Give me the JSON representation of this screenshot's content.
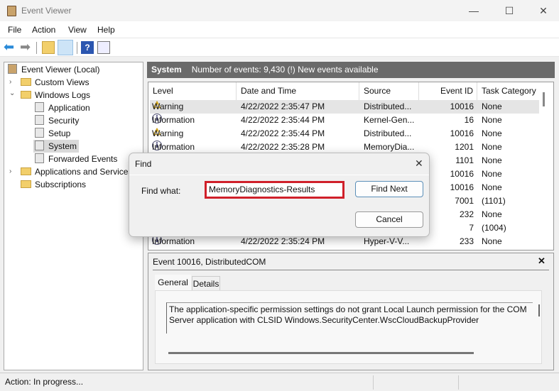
{
  "window": {
    "title": "Event Viewer",
    "minimize": "—",
    "maximize": "☐",
    "close": "✕"
  },
  "menu": [
    "File",
    "Action",
    "View",
    "Help"
  ],
  "toolbar": {
    "icons": [
      "back-arrow-icon",
      "forward-arrow-icon",
      "up-folder-icon",
      "show-hide-console-tree-icon",
      "help-icon",
      "show-hide-action-pane-icon"
    ],
    "help_glyph": "?"
  },
  "tree": [
    {
      "label": "Event Viewer (Local)",
      "icon": "event-viewer-icon"
    },
    {
      "label": "Custom Views",
      "icon": "folder-filter-icon",
      "chevron": "›"
    },
    {
      "label": "Windows Logs",
      "icon": "folder-log-icon",
      "chevron": "⌄"
    },
    {
      "label": "Application",
      "icon": "log-icon"
    },
    {
      "label": "Security",
      "icon": "log-icon"
    },
    {
      "label": "Setup",
      "icon": "log-icon"
    },
    {
      "label": "System",
      "icon": "log-icon",
      "selected": true
    },
    {
      "label": "Forwarded Events",
      "icon": "log-icon"
    },
    {
      "label": "Applications and Services",
      "icon": "folder-icon",
      "chevron": "›"
    },
    {
      "label": "Subscriptions",
      "icon": "subscriptions-icon"
    }
  ],
  "header": {
    "log": "System",
    "info": "Number of events: 9,430 (!) New events available"
  },
  "table": {
    "columns": [
      "Level",
      "Date and Time",
      "Source",
      "Event ID",
      "Task Category"
    ],
    "rows": [
      {
        "level": "Warning",
        "date": "4/22/2022 2:35:47 PM",
        "source": "Distributed...",
        "id": "10016",
        "task": "None"
      },
      {
        "level": "Information",
        "date": "4/22/2022 2:35:44 PM",
        "source": "Kernel-Gen...",
        "id": "16",
        "task": "None"
      },
      {
        "level": "Warning",
        "date": "4/22/2022 2:35:44 PM",
        "source": "Distributed...",
        "id": "10016",
        "task": "None"
      },
      {
        "level": "Information",
        "date": "4/22/2022 2:35:28 PM",
        "source": "MemoryDia...",
        "id": "1201",
        "task": "None"
      },
      {
        "id": "1101",
        "task": "None"
      },
      {
        "id": "10016",
        "task": "None"
      },
      {
        "id": "10016",
        "task": "None"
      },
      {
        "id": "7001",
        "task": "(1101)"
      },
      {
        "id": "232",
        "task": "None"
      },
      {
        "id": "7",
        "task": "(1004)"
      },
      {
        "level": "Information",
        "date": "4/22/2022 2:35:24 PM",
        "source": "Hyper-V-V...",
        "id": "233",
        "task": "None"
      }
    ]
  },
  "details": {
    "title": "Event 10016, DistributedCOM",
    "close": "✕",
    "tabs": [
      "General",
      "Details"
    ],
    "text": "The application-specific permission settings do not grant Local Launch permission for the COM Server application with CLSID Windows.SecurityCenter.WscCloudBackupProvider"
  },
  "find_dialog": {
    "title": "Find",
    "close": "✕",
    "label": "Find what:",
    "value": "MemoryDiagnostics-Results",
    "find_next": "Find Next",
    "cancel": "Cancel",
    "highlight_color": "#d0202a"
  },
  "status": {
    "text": "Action:  In progress..."
  }
}
